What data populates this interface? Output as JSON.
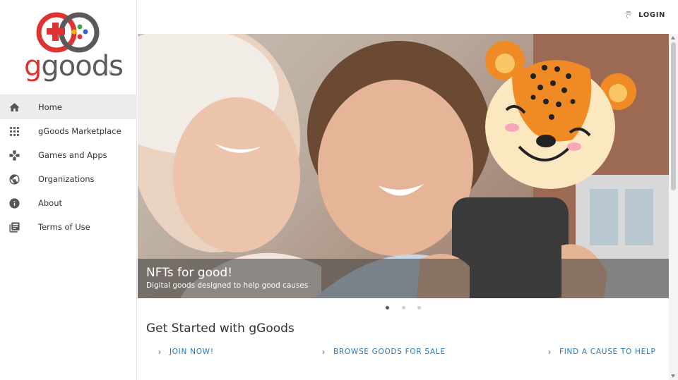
{
  "brand": {
    "logo_text_g": "g",
    "logo_text_rest": "goods",
    "registered": "®"
  },
  "sidebar": {
    "items": [
      {
        "label": "Home",
        "icon": "home-icon",
        "active": true
      },
      {
        "label": "gGoods Marketplace",
        "icon": "grid-icon",
        "active": false
      },
      {
        "label": "Games and Apps",
        "icon": "gamepad-icon",
        "active": false
      },
      {
        "label": "Organizations",
        "icon": "globe-icon",
        "active": false
      },
      {
        "label": "About",
        "icon": "info-icon",
        "active": false
      },
      {
        "label": "Terms of Use",
        "icon": "library-icon",
        "active": false
      }
    ]
  },
  "header": {
    "login_label": "LOGIN",
    "login_icon": "fingerprint-icon"
  },
  "hero": {
    "title": "NFTs for good!",
    "subtitle": "Digital goods designed to help good causes",
    "slides": 3,
    "active_slide": 1
  },
  "main": {
    "section_title": "Get Started with gGoods",
    "ctas": [
      {
        "label": "JOIN NOW!"
      },
      {
        "label": "BROWSE GOODS FOR SALE"
      },
      {
        "label": "FIND A CAUSE TO HELP"
      }
    ]
  },
  "colors": {
    "brand_red": "#dd3333",
    "link_blue": "#2a7bb5",
    "cheetah_orange": "#f08a24"
  }
}
